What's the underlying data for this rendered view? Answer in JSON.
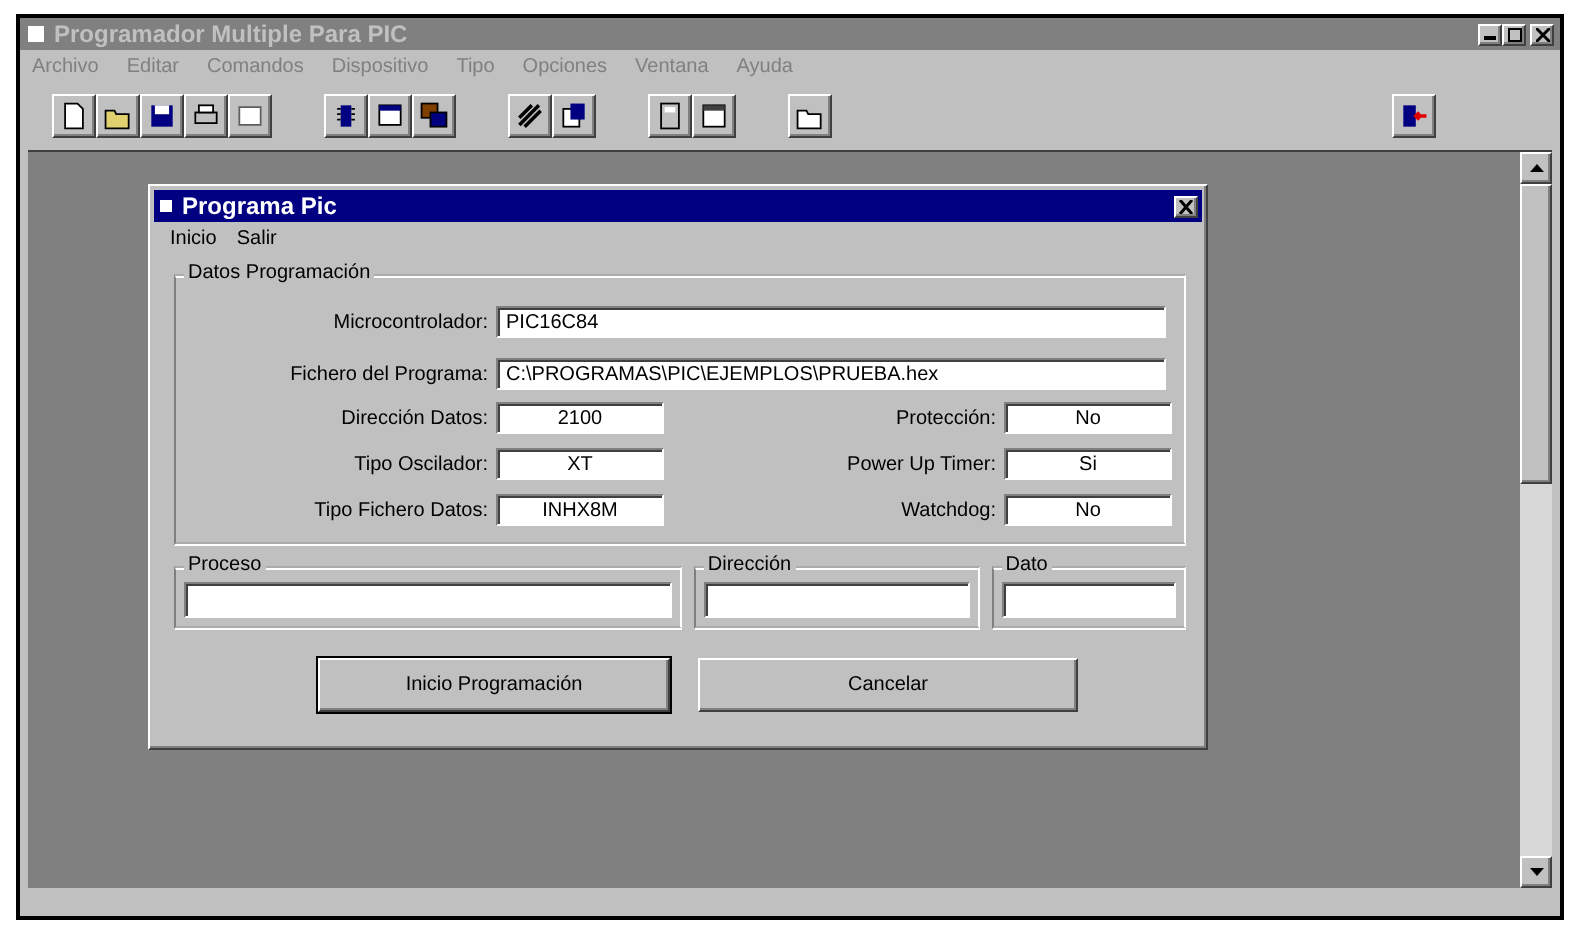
{
  "window": {
    "title": "Programador Multiple Para PIC"
  },
  "menu": [
    "Archivo",
    "Editar",
    "Comandos",
    "Dispositivo",
    "Tipo",
    "Opciones",
    "Ventana",
    "Ayuda"
  ],
  "dialog": {
    "title": "Programa Pic",
    "menu": [
      "Inicio",
      "Salir"
    ],
    "group": "Datos Programación",
    "wide_fields": [
      {
        "label": "Microcontrolador:",
        "value": "PIC16C84"
      },
      {
        "label": "Fichero del Programa:",
        "value": "C:\\PROGRAMAS\\PIC\\EJEMPLOS\\PRUEBA.hex"
      }
    ],
    "left_fields": [
      {
        "label": "Dirección Datos:",
        "value": "2100"
      },
      {
        "label": "Tipo Oscilador:",
        "value": "XT"
      },
      {
        "label": "Tipo Fichero Datos:",
        "value": "INHX8M"
      }
    ],
    "right_fields": [
      {
        "label": "Protección:",
        "value": "No"
      },
      {
        "label": "Power Up Timer:",
        "value": "Si"
      },
      {
        "label": "Watchdog:",
        "value": "No"
      }
    ],
    "status_groups": [
      "Proceso",
      "Dirección",
      "Dato"
    ],
    "buttons": [
      {
        "label": "Inicio Programación",
        "default": true
      },
      {
        "label": "Cancelar",
        "default": false
      }
    ]
  }
}
